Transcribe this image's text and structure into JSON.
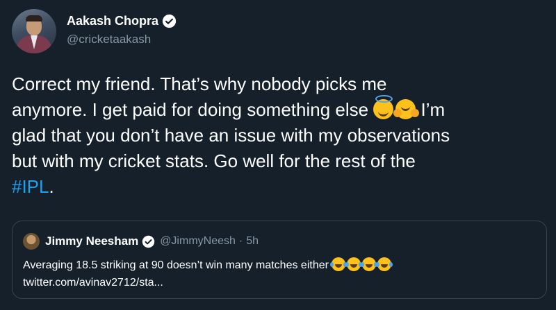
{
  "author": {
    "name": "Aakash Chopra",
    "handle": "@cricketaakash",
    "verified": true
  },
  "tweet": {
    "line1": "Correct my friend. That’s why nobody picks me",
    "line2_pre": "anymore. I get paid for doing something else ",
    "line2_post": " I’m",
    "line3": "glad that you don’t have an issue with my observations",
    "line4": "but with my cricket stats. Go well for the rest of the",
    "hashtag": "#IPL",
    "after_hashtag": ".",
    "emojis": [
      "smiling-face-with-halo",
      "hugging-face"
    ]
  },
  "quoted": {
    "name": "Jimmy Neesham",
    "handle": "@JimmyNeesh",
    "separator": "·",
    "time": "5h",
    "verified": true,
    "text": "Averaging 18.5 striking at 90 doesn’t win many matches either ",
    "link": "twitter.com/avinav2712/sta...",
    "emojis": [
      "face-with-tears-of-joy",
      "face-with-tears-of-joy",
      "face-with-tears-of-joy",
      "face-with-tears-of-joy"
    ]
  },
  "colors": {
    "background": "#15202b",
    "text": "#ffffff",
    "secondary": "#8899a6",
    "accent": "#1da1f2",
    "border": "#38444d"
  }
}
